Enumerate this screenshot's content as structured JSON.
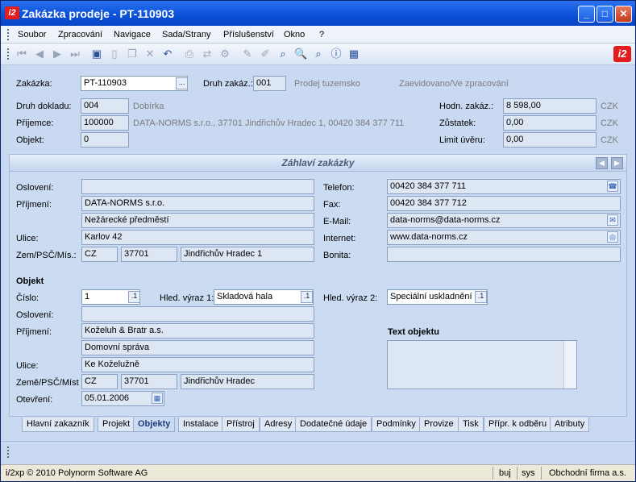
{
  "window": {
    "title": "Zakázka prodeje - PT-110903",
    "app_icon": "i2"
  },
  "menu": [
    "Soubor",
    "Zpracování",
    "Navigace",
    "Sada/Strany",
    "Příslušenství",
    "Okno",
    "?"
  ],
  "header": {
    "zakazka_label": "Zakázka:",
    "zakazka_value": "PT-110903",
    "druh_zakaz_label": "Druh zakáz.:",
    "druh_zakaz_value": "001",
    "druh_zakaz_text": "Prodej tuzemsko",
    "state_text": "Zaevidovano/Ve zpracování",
    "druh_dokladu_label": "Druh dokladu:",
    "druh_dokladu_value": "004",
    "druh_dokladu_text": "Dobírka",
    "prijemce_label": "Příjemce:",
    "prijemce_value": "100000",
    "prijemce_text": "DATA-NORMS s.r.o., 37701 Jindřichův Hradec 1, 00420 384 377 711",
    "objekt_label": "Objekt:",
    "objekt_value": "0",
    "hodn_label": "Hodn. zakáz.:",
    "hodn_value": "8 598,00",
    "hodn_cur": "CZK",
    "zustatek_label": "Zůstatek:",
    "zustatek_value": "0,00",
    "zustatek_cur": "CZK",
    "limit_label": "Limit úvěru:",
    "limit_value": "0,00",
    "limit_cur": "CZK"
  },
  "panel": {
    "title": "Záhlaví zakázky",
    "osloveni_label": "Oslovení:",
    "osloveni_value": "",
    "prijmeni_label": "Příjmení:",
    "prijmeni_value": "DATA-NORMS s.r.o.",
    "prijmeni_value2": "Nežárecké předměstí",
    "ulice_label": "Ulice:",
    "ulice_value": "Karlov 42",
    "zem_label": "Zem/PSČ/Mís.:",
    "zem_value": "CZ",
    "psc_value": "37701",
    "misto_value": "Jindřichův Hradec 1",
    "telefon_label": "Telefon:",
    "telefon_value": "00420 384 377 711",
    "fax_label": "Fax:",
    "fax_value": "00420 384 377 712",
    "email_label": "E-Mail:",
    "email_value": "data-norms@data-norms.cz",
    "internet_label": "Internet:",
    "internet_value": "www.data-norms.cz",
    "bonita_label": "Bonita:",
    "bonita_value": "",
    "objekt_heading": "Objekt",
    "cislo_label": "Číslo:",
    "cislo_value": "1",
    "hled1_label": "Hled. výraz 1:",
    "hled1_value": "Skladová hala",
    "hled2_label": "Hled. výraz 2:",
    "hled2_value": "Speciální uskladnění",
    "o_osloveni_label": "Oslovení:",
    "o_osloveni_value": "",
    "o_prijmeni_label": "Příjmení:",
    "o_prijmeni_value": "Koželuh & Bratr a.s.",
    "o_prijmeni_value2": "Domovní správa",
    "o_ulice_label": "Ulice:",
    "o_ulice_value": "Ke Koželužně",
    "o_zem_label": "Země/PSČ/Míst",
    "o_zem_value": "CZ",
    "o_psc_value": "37701",
    "o_misto_value": "Jindřichův Hradec",
    "otevreni_label": "Otevření:",
    "otevreni_value": "05.01.2006",
    "text_objektu_label": "Text objektu"
  },
  "tabs": [
    "Hlavní zakazník",
    "Projekt",
    "Objekty",
    "Instalace",
    "Přístroj",
    "Adresy",
    "Dodatečné údaje",
    "Podmínky",
    "Provize",
    "Tisk",
    "Přípr. k odběru",
    "Atributy"
  ],
  "status": {
    "copyright": "i/2xp © 2010 Polynorm Software AG",
    "user": "buj",
    "db": "sys",
    "company": "Obchodní firma a.s."
  }
}
